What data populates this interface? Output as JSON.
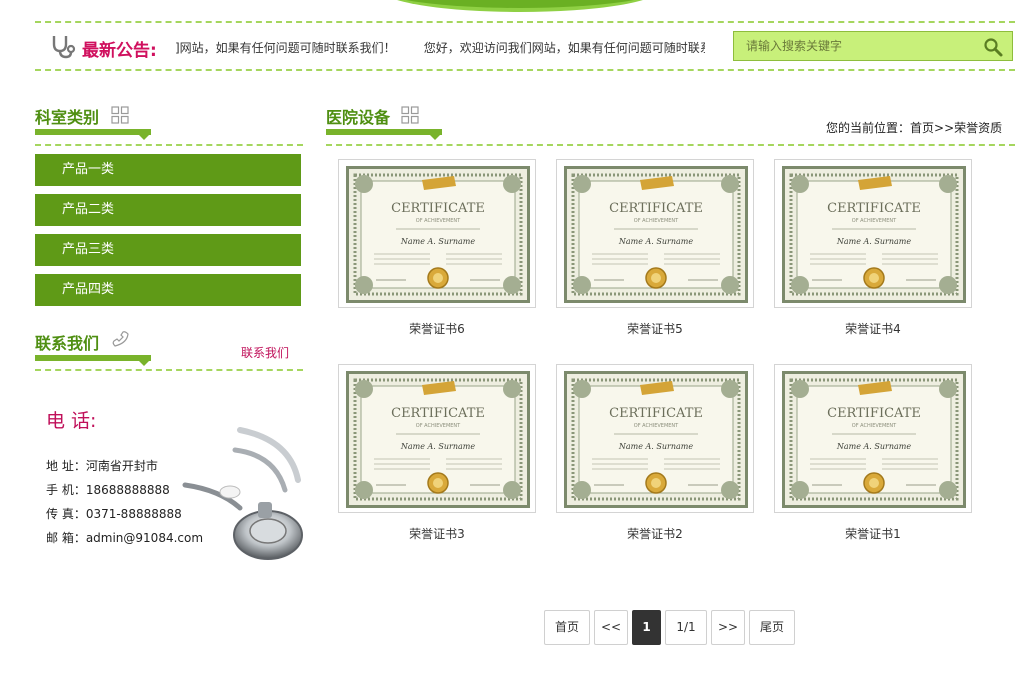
{
  "notice": {
    "title": "最新公告:",
    "messages": [
      "]网站，如果有任何问题可随时联系我们！",
      "您好，欢迎访问我们网站，如果有任何问题可随时联系"
    ]
  },
  "search": {
    "placeholder": "请输入搜索关键字"
  },
  "sidebar": {
    "categories_title": "科室类别",
    "categories": [
      "产品一类",
      "产品二类",
      "产品三类",
      "产品四类"
    ],
    "contact_title": "联系我们",
    "contact_link": "联系我们",
    "phone_label": "电 话:",
    "info": [
      "地 址：河南省开封市",
      "手 机：18688888888",
      "传 真：0371-88888888",
      "邮 箱：admin@91084.com"
    ]
  },
  "main": {
    "title": "医院设备",
    "breadcrumb_prefix": "您的当前位置：",
    "breadcrumb_home": "首页",
    "breadcrumb_sep": ">>",
    "breadcrumb_current": "荣誉资质",
    "certificate_text": {
      "heading": "CERTIFICATE",
      "sub": "OF ACHIEVEMENT",
      "name": "Name A. Surname"
    },
    "items": [
      {
        "caption": "荣誉证书6"
      },
      {
        "caption": "荣誉证书5"
      },
      {
        "caption": "荣誉证书4"
      },
      {
        "caption": "荣誉证书3"
      },
      {
        "caption": "荣誉证书2"
      },
      {
        "caption": "荣誉证书1"
      }
    ]
  },
  "pagination": {
    "first": "首页",
    "prev": "<<",
    "current": "1",
    "info": "1/1",
    "next": ">>",
    "last": "尾页"
  },
  "colors": {
    "accent_green": "#5f9a17",
    "dash_green": "#a5d65e",
    "magenta": "#d0105e",
    "search_bg": "#c8f07a"
  }
}
